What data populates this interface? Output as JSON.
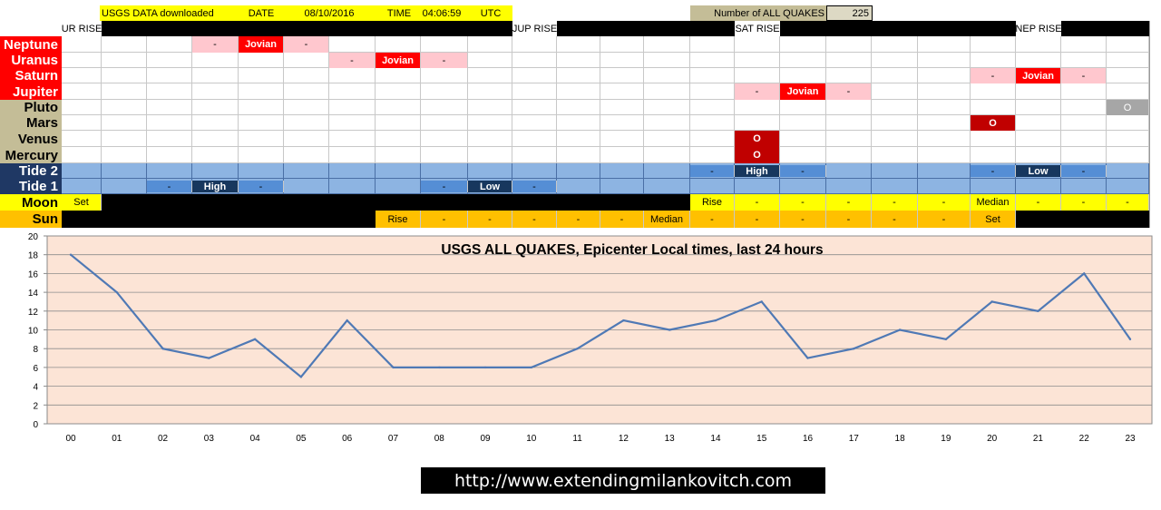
{
  "header": {
    "usgs_label": "USGS DATA downloaded",
    "date_label": "DATE",
    "date_value": "08/10/2016",
    "time_label": "TIME",
    "time_value": "04:06:59",
    "tz": "UTC",
    "count_label": "Number of ALL QUAKES",
    "count_value": "225"
  },
  "rise_labels": {
    "ur": "UR RISE",
    "jup": "JUP RISE",
    "sat": "SAT RISE",
    "nep": "NEP RISE"
  },
  "rows": [
    {
      "label": "Neptune",
      "cells": [
        [
          3,
          "-",
          "pink"
        ],
        [
          4,
          "Jovian",
          "red"
        ],
        [
          5,
          "-",
          "pink"
        ]
      ]
    },
    {
      "label": "Uranus",
      "cells": [
        [
          6,
          "-",
          "pink"
        ],
        [
          7,
          "Jovian",
          "red"
        ],
        [
          8,
          "-",
          "pink"
        ]
      ]
    },
    {
      "label": "Saturn",
      "cells": [
        [
          20,
          "-",
          "pink"
        ],
        [
          21,
          "Jovian",
          "red"
        ],
        [
          22,
          "-",
          "pink"
        ]
      ]
    },
    {
      "label": "Jupiter",
      "cells": [
        [
          15,
          "-",
          "pink"
        ],
        [
          16,
          "Jovian",
          "red"
        ],
        [
          17,
          "-",
          "pink"
        ]
      ]
    },
    {
      "label": "Pluto",
      "cells": [
        [
          23,
          "O",
          "gray"
        ]
      ]
    },
    {
      "label": "Mars",
      "cells": [
        [
          20,
          "O",
          "darkred"
        ]
      ]
    },
    {
      "label": "Venus",
      "cells": [
        [
          15,
          "O",
          "darkred"
        ]
      ]
    },
    {
      "label": "Mercury",
      "cells": [
        [
          15,
          "O",
          "darkred"
        ]
      ]
    },
    {
      "label": "Tide 2",
      "cells": [
        [
          14,
          "-",
          "mid"
        ],
        [
          15,
          "High",
          "navy"
        ],
        [
          16,
          "-",
          "mid"
        ],
        [
          20,
          "-",
          "mid"
        ],
        [
          21,
          "Low",
          "navy"
        ],
        [
          22,
          "-",
          "mid"
        ]
      ]
    },
    {
      "label": "Tide 1",
      "cells": [
        [
          2,
          "-",
          "mid"
        ],
        [
          3,
          "High",
          "navy"
        ],
        [
          4,
          "-",
          "mid"
        ],
        [
          8,
          "-",
          "mid"
        ],
        [
          9,
          "Low",
          "navy"
        ],
        [
          10,
          "-",
          "mid"
        ]
      ]
    },
    {
      "label": "Moon",
      "cells": [
        [
          0,
          "Set",
          "yellow"
        ],
        [
          14,
          "Rise",
          "yellow"
        ],
        [
          15,
          "-",
          "yellow"
        ],
        [
          16,
          "-",
          "yellow"
        ],
        [
          17,
          "-",
          "yellow"
        ],
        [
          18,
          "-",
          "yellow"
        ],
        [
          19,
          "-",
          "yellow"
        ],
        [
          20,
          "Median",
          "yellow"
        ],
        [
          21,
          "-",
          "yellow"
        ],
        [
          22,
          "-",
          "yellow"
        ],
        [
          23,
          "-",
          "yellow"
        ],
        [
          24,
          "-",
          "yellow"
        ]
      ]
    },
    {
      "label": "Sun",
      "cells": [
        [
          7,
          "Rise",
          "orange"
        ],
        [
          8,
          "-",
          "orange"
        ],
        [
          9,
          "-",
          "orange"
        ],
        [
          10,
          "-",
          "orange"
        ],
        [
          11,
          "-",
          "orange"
        ],
        [
          12,
          "-",
          "orange"
        ],
        [
          13,
          "Median",
          "orange"
        ],
        [
          14,
          "-",
          "orange"
        ],
        [
          15,
          "-",
          "orange"
        ],
        [
          16,
          "-",
          "orange"
        ],
        [
          17,
          "-",
          "orange"
        ],
        [
          18,
          "-",
          "orange"
        ],
        [
          19,
          "-",
          "orange"
        ],
        [
          20,
          "Set",
          "orange"
        ]
      ]
    }
  ],
  "colors": {
    "pink": "#ffc7ce",
    "red": "#ff0000",
    "darkred": "#c00000",
    "gray": "#a6a6a6",
    "mid": "#558ed5",
    "navy": "#17375e",
    "light": "#8db4e2",
    "yellow": "#ffff00",
    "orange": "#ffc000",
    "bg_chart": "#fce4d6",
    "line": "#4f79b5"
  },
  "chart_data": {
    "type": "line",
    "title": "USGS ALL QUAKES, Epicenter Local times, last 24 hours",
    "categories": [
      "00",
      "01",
      "02",
      "03",
      "04",
      "05",
      "06",
      "07",
      "08",
      "09",
      "10",
      "11",
      "12",
      "13",
      "14",
      "15",
      "16",
      "17",
      "18",
      "19",
      "20",
      "21",
      "22",
      "23"
    ],
    "values": [
      18,
      14,
      8,
      7,
      9,
      5,
      11,
      6,
      6,
      6,
      6,
      8,
      11,
      10,
      11,
      13,
      7,
      8,
      10,
      9,
      13,
      12,
      16,
      9
    ],
    "ylim": [
      0,
      20
    ],
    "yticks": [
      0,
      2,
      4,
      6,
      8,
      10,
      12,
      14,
      16,
      18,
      20
    ],
    "grid": true
  },
  "footer_url": "http://www.extendingmilankovitch.com"
}
